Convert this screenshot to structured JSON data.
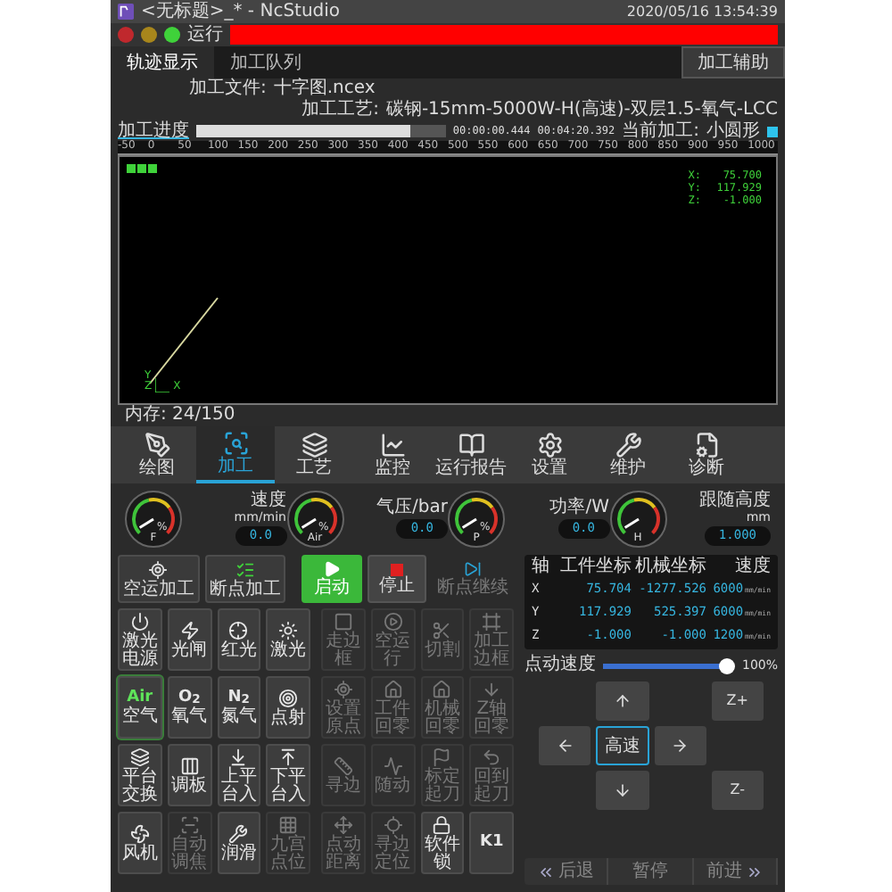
{
  "window": {
    "title": "<无标题>_* - NcStudio",
    "datetime": "2020/05/16 13:54:39"
  },
  "status": {
    "lights": [
      {
        "color": "#c0282d"
      },
      {
        "color": "#a8861c"
      },
      {
        "color": "#3fd23a"
      }
    ],
    "state": "运行"
  },
  "tabs": [
    {
      "label": "轨迹显示",
      "selected": true
    },
    {
      "label": "加工队列",
      "selected": false
    }
  ],
  "assist_tab": {
    "label": "加工辅助"
  },
  "file": {
    "label": "加工文件:",
    "value": "十字图.ncex"
  },
  "process": {
    "label": "加工工艺:",
    "value": "碳钢-15mm-5000W-H(高速)-双层1.5-氧气-LCC"
  },
  "progress": {
    "label": "加工进度",
    "level": 0.86,
    "elapsed": "00:00:00.444",
    "total": "00:04:20.392",
    "current_label": "当前加工:",
    "current_value": "小圆形"
  },
  "ruler": [
    "-50",
    "0",
    "50",
    "100",
    "150",
    "200",
    "250",
    "300",
    "350",
    "400",
    "450",
    "500",
    "550",
    "600",
    "650",
    "700",
    "750",
    "800",
    "850",
    "900",
    "950",
    "1000"
  ],
  "canvas": {
    "coords": [
      {
        "axis": "X:",
        "value": "75.700"
      },
      {
        "axis": "Y:",
        "value": "117.929"
      },
      {
        "axis": "Z:",
        "value": "-1.000"
      }
    ],
    "axes": {
      "y": "Y",
      "z": "Z",
      "x": "X"
    }
  },
  "memory": "内存: 24/150",
  "nav": [
    {
      "label": "绘图",
      "selected": false
    },
    {
      "label": "加工",
      "selected": true
    },
    {
      "label": "工艺",
      "selected": false
    },
    {
      "label": "监控",
      "selected": false
    },
    {
      "label": "运行报告",
      "selected": false
    },
    {
      "label": "设置",
      "selected": false
    },
    {
      "label": "维护",
      "selected": false
    },
    {
      "label": "诊断",
      "selected": false
    }
  ],
  "gauges": [
    {
      "symbol": "F",
      "mark": "%",
      "label": "速度",
      "unit": "mm/min",
      "value": "0.0"
    },
    {
      "symbol": "Air",
      "mark": "%",
      "label": "气压/bar",
      "value": "0.0"
    },
    {
      "symbol": "P",
      "mark": "%",
      "label": "功率/W",
      "value": "0.0"
    },
    {
      "symbol": "H",
      "label": "跟随高度",
      "unit": "mm",
      "value": "1.000"
    }
  ],
  "actions": [
    {
      "kind": "sim",
      "label": "空运加工"
    },
    {
      "kind": "break",
      "label": "断点加工"
    },
    {
      "kind": "start",
      "label": "启动"
    },
    {
      "kind": "stop",
      "label": "停止"
    },
    {
      "kind": "resume",
      "label": "断点继续",
      "disabled": true
    }
  ],
  "left_grid": [
    {
      "kind": "icon",
      "label": "激光电源",
      "disabled": false
    },
    {
      "kind": "icon",
      "label": "光闸",
      "disabled": false
    },
    {
      "kind": "icon",
      "label": "红光",
      "disabled": false
    },
    {
      "kind": "icon",
      "label": "激光",
      "disabled": false
    },
    {
      "kind": "text_icon",
      "icon_text": "Air",
      "label": "空气",
      "disabled": false,
      "on": true
    },
    {
      "kind": "text_icon",
      "icon_text": "O$_{2}$",
      "label": "氧气",
      "disabled": false,
      "on": false
    },
    {
      "kind": "text_icon",
      "icon_text": "N$_{2}$",
      "label": "氮气",
      "disabled": false,
      "on": false
    },
    {
      "kind": "icon",
      "label": "点射",
      "disabled": false
    },
    {
      "kind": "icon",
      "label": "平台交换",
      "disabled": false
    },
    {
      "kind": "icon",
      "label": "调板",
      "disabled": false
    },
    {
      "kind": "icon",
      "label": "上平台入",
      "disabled": false
    },
    {
      "kind": "icon",
      "label": "下平台入",
      "disabled": false
    },
    {
      "kind": "icon",
      "label": "风机",
      "disabled": false
    },
    {
      "kind": "icon",
      "label": "自动调焦",
      "disabled": true
    },
    {
      "kind": "icon",
      "label": "润滑",
      "disabled": false
    },
    {
      "kind": "icon",
      "label": "九宫点位",
      "disabled": true
    }
  ],
  "mid_grid": [
    {
      "kind": "icon",
      "label": "走边框",
      "disabled": true
    },
    {
      "kind": "icon",
      "label": "空运行",
      "disabled": true
    },
    {
      "kind": "icon",
      "label": "切割",
      "disabled": true
    },
    {
      "kind": "icon",
      "label": "加工边框",
      "disabled": true
    },
    {
      "kind": "icon",
      "label": "设置原点",
      "disabled": true
    },
    {
      "kind": "icon",
      "label": "工件回零",
      "disabled": true
    },
    {
      "kind": "icon",
      "label": "机械回零",
      "disabled": true
    },
    {
      "kind": "icon",
      "label": "Z轴回零",
      "disabled": true
    },
    {
      "kind": "icon",
      "label": "寻边",
      "disabled": true
    },
    {
      "kind": "icon",
      "label": "随动",
      "disabled": true
    },
    {
      "kind": "icon",
      "label": "标定起刀",
      "disabled": true
    },
    {
      "kind": "icon",
      "label": "回到起刀",
      "disabled": true
    },
    {
      "kind": "icon",
      "label": "点动距离",
      "disabled": true
    },
    {
      "kind": "icon",
      "label": "寻边定位",
      "disabled": true
    },
    {
      "kind": "icon",
      "label": "软件锁",
      "disabled": false
    },
    {
      "kind": "text_icon",
      "icon_text": "K1",
      "disabled": false
    }
  ],
  "coords": {
    "columns": [
      "轴",
      "工件坐标",
      "机械坐标",
      "速度"
    ],
    "rows": [
      {
        "axis": "X",
        "work": "75.704",
        "machine": "-1277.526",
        "speed": "6000",
        "unit": "mm/min"
      },
      {
        "axis": "Y",
        "work": "117.929",
        "machine": "525.397",
        "speed": "6000",
        "unit": "mm/min"
      },
      {
        "axis": "Z",
        "work": "-1.000",
        "machine": "-1.000",
        "speed": "1200",
        "unit": "mm/min"
      }
    ]
  },
  "jog": {
    "speed_label": "点动速度",
    "level": 0.93,
    "reading": "100%",
    "high_speed": {
      "label": "高速",
      "on": true
    },
    "z_up": "Z+",
    "z_down": "Z-"
  },
  "playback": [
    {
      "kind": "back",
      "label": "后退"
    },
    {
      "kind": "pause",
      "label": "暂停"
    },
    {
      "kind": "forward",
      "label": "前进"
    }
  ]
}
